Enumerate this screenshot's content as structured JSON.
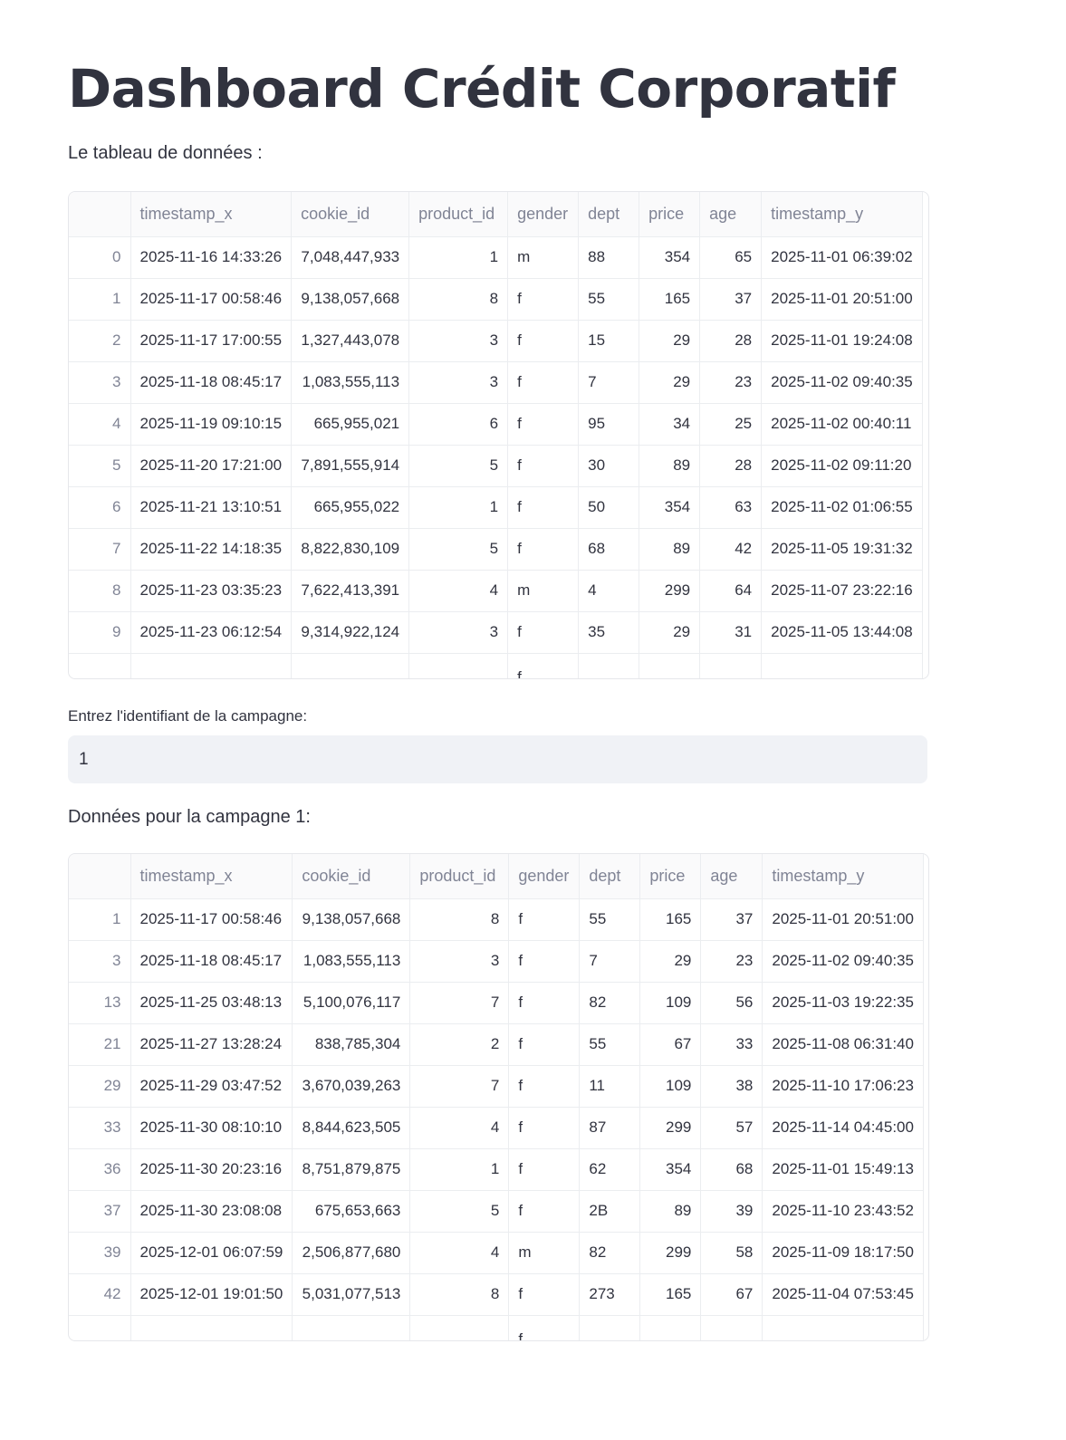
{
  "page": {
    "title": "Dashboard Crédit Corporatif",
    "table_caption": "Le tableau de données :",
    "input_label": "Entrez l'identifiant de la campagne:",
    "input_value": "1",
    "filtered_caption": "Données pour la campagne 1:"
  },
  "columns": [
    "timestamp_x",
    "cookie_id",
    "product_id",
    "gender",
    "dept",
    "price",
    "age",
    "timestamp_y"
  ],
  "table_main": {
    "rows": [
      [
        "0",
        "2025-11-16 14:33:26",
        "7,048,447,933",
        "1",
        "m",
        "88",
        "354",
        "65",
        "2025-11-01 06:39:02"
      ],
      [
        "1",
        "2025-11-17 00:58:46",
        "9,138,057,668",
        "8",
        "f",
        "55",
        "165",
        "37",
        "2025-11-01 20:51:00"
      ],
      [
        "2",
        "2025-11-17 17:00:55",
        "1,327,443,078",
        "3",
        "f",
        "15",
        "29",
        "28",
        "2025-11-01 19:24:08"
      ],
      [
        "3",
        "2025-11-18 08:45:17",
        "1,083,555,113",
        "3",
        "f",
        "7",
        "29",
        "23",
        "2025-11-02 09:40:35"
      ],
      [
        "4",
        "2025-11-19 09:10:15",
        "665,955,021",
        "6",
        "f",
        "95",
        "34",
        "25",
        "2025-11-02 00:40:11"
      ],
      [
        "5",
        "2025-11-20 17:21:00",
        "7,891,555,914",
        "5",
        "f",
        "30",
        "89",
        "28",
        "2025-11-02 09:11:20"
      ],
      [
        "6",
        "2025-11-21 13:10:51",
        "665,955,022",
        "1",
        "f",
        "50",
        "354",
        "63",
        "2025-11-02 01:06:55"
      ],
      [
        "7",
        "2025-11-22 14:18:35",
        "8,822,830,109",
        "5",
        "f",
        "68",
        "89",
        "42",
        "2025-11-05 19:31:32"
      ],
      [
        "8",
        "2025-11-23 03:35:23",
        "7,622,413,391",
        "4",
        "m",
        "4",
        "299",
        "64",
        "2025-11-07 23:22:16"
      ],
      [
        "9",
        "2025-11-23 06:12:54",
        "9,314,922,124",
        "3",
        "f",
        "35",
        "29",
        "31",
        "2025-11-05 13:44:08"
      ]
    ],
    "partial_row_gender": "f"
  },
  "table_filtered": {
    "rows": [
      [
        "1",
        "2025-11-17 00:58:46",
        "9,138,057,668",
        "8",
        "f",
        "55",
        "165",
        "37",
        "2025-11-01 20:51:00"
      ],
      [
        "3",
        "2025-11-18 08:45:17",
        "1,083,555,113",
        "3",
        "f",
        "7",
        "29",
        "23",
        "2025-11-02 09:40:35"
      ],
      [
        "13",
        "2025-11-25 03:48:13",
        "5,100,076,117",
        "7",
        "f",
        "82",
        "109",
        "56",
        "2025-11-03 19:22:35"
      ],
      [
        "21",
        "2025-11-27 13:28:24",
        "838,785,304",
        "2",
        "f",
        "55",
        "67",
        "33",
        "2025-11-08 06:31:40"
      ],
      [
        "29",
        "2025-11-29 03:47:52",
        "3,670,039,263",
        "7",
        "f",
        "11",
        "109",
        "38",
        "2025-11-10 17:06:23"
      ],
      [
        "33",
        "2025-11-30 08:10:10",
        "8,844,623,505",
        "4",
        "f",
        "87",
        "299",
        "57",
        "2025-11-14 04:45:00"
      ],
      [
        "36",
        "2025-11-30 20:23:16",
        "8,751,879,875",
        "1",
        "f",
        "62",
        "354",
        "68",
        "2025-11-01 15:49:13"
      ],
      [
        "37",
        "2025-11-30 23:08:08",
        "675,653,663",
        "5",
        "f",
        "2B",
        "89",
        "39",
        "2025-11-10 23:43:52"
      ],
      [
        "39",
        "2025-12-01 06:07:59",
        "2,506,877,680",
        "4",
        "m",
        "82",
        "299",
        "58",
        "2025-11-09 18:17:50"
      ],
      [
        "42",
        "2025-12-01 19:01:50",
        "5,031,077,513",
        "8",
        "f",
        "273",
        "165",
        "67",
        "2025-11-04 07:53:45"
      ]
    ],
    "partial_row_gender": "f"
  }
}
